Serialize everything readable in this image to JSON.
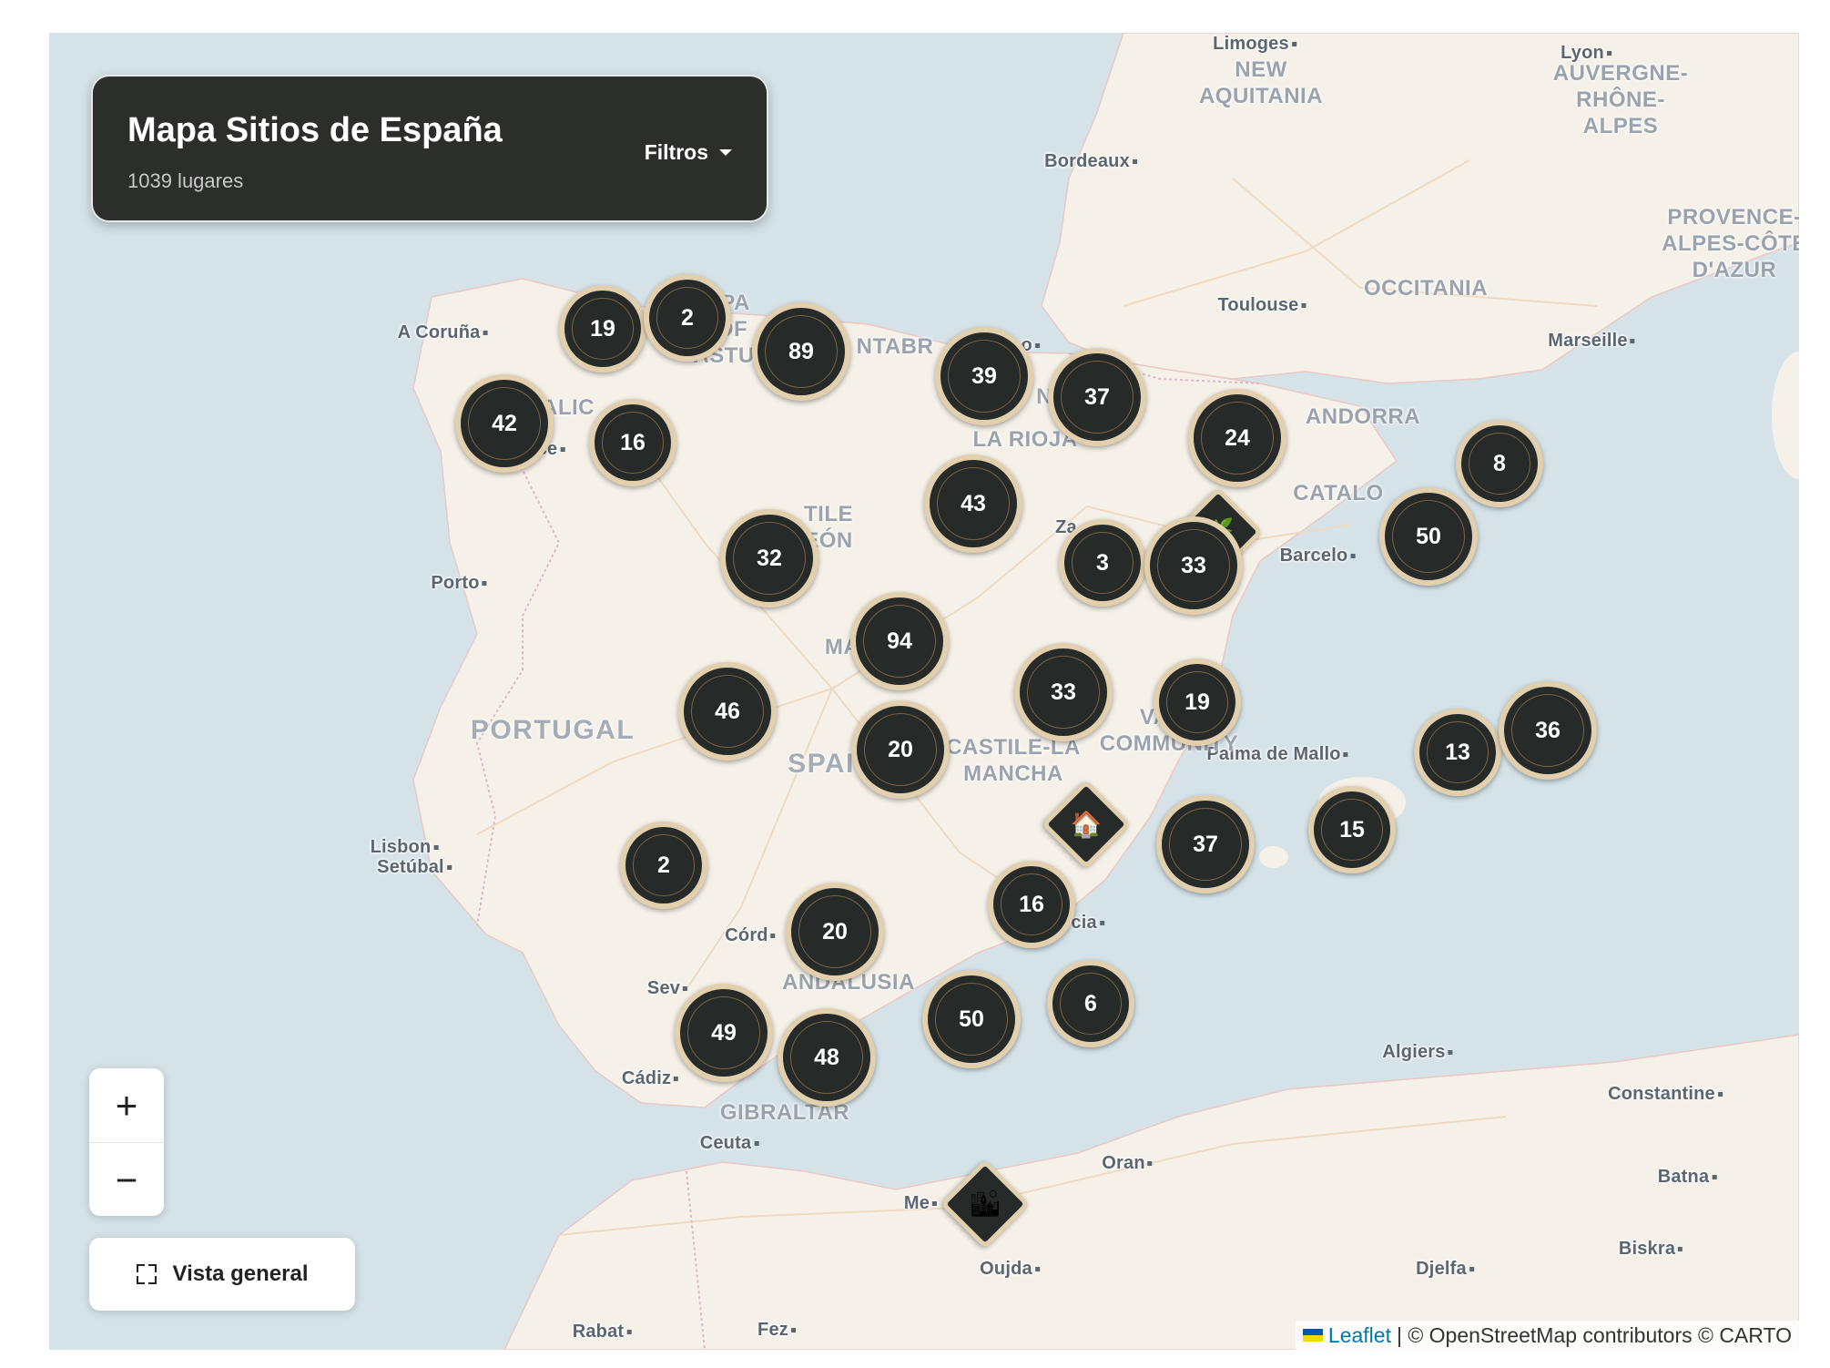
{
  "panel": {
    "title": "Mapa Sitios de España",
    "subtitle": "1039 lugares",
    "filters_label": "Filtros"
  },
  "zoom": {
    "in_label": "+",
    "out_label": "−"
  },
  "overview_label": "Vista general",
  "attribution": {
    "leaflet": "Leaflet",
    "text": "| © OpenStreetMap contributors © CARTO"
  },
  "colors": {
    "water": "#d5e3e8",
    "land": "#f5f1e9",
    "cluster_fill": "#262a28",
    "cluster_ring": "#e2cfae",
    "panel_bg": "#2c2e2c"
  },
  "places": [
    {
      "label": "Limoges"
    },
    {
      "label": "Lyon"
    },
    {
      "label": "Bordeaux"
    },
    {
      "label": "Toulouse"
    },
    {
      "label": "Marseille"
    },
    {
      "label": "A Coruña"
    },
    {
      "label": "Porto"
    },
    {
      "label": "Lisbon"
    },
    {
      "label": "Setúbal"
    },
    {
      "label": "Barcelo"
    },
    {
      "label": "Palma de Mallo"
    },
    {
      "label": "Murcia"
    },
    {
      "label": "Córd"
    },
    {
      "label": "Sev"
    },
    {
      "label": "Cádiz"
    },
    {
      "label": "Ceuta"
    },
    {
      "label": "Algiers"
    },
    {
      "label": "Constantine"
    },
    {
      "label": "Oran"
    },
    {
      "label": "Batna"
    },
    {
      "label": "Biskra"
    },
    {
      "label": "Me"
    },
    {
      "label": "Oujda"
    },
    {
      "label": "Djelfa"
    },
    {
      "label": "Rabat"
    },
    {
      "label": "Fez"
    },
    {
      "label": "ao"
    },
    {
      "label": "Za"
    },
    {
      "label": "se"
    }
  ],
  "regions": [
    {
      "label": "NEW\nAQUITANIA"
    },
    {
      "label": "AUVERGNE-\nRHÔNE-\nALPES"
    },
    {
      "label": "PROVENCE-\nALPES-CÔTE\nD'AZUR"
    },
    {
      "label": "OCCITANIA"
    },
    {
      "label": "ANDORRA"
    },
    {
      "label": "CATALO"
    },
    {
      "label": "LA RIOJA"
    },
    {
      "label": "ANDALUSIA"
    },
    {
      "label": "GIBRALTAR"
    },
    {
      "label": "CASTILE-LA\nMANCHA"
    },
    {
      "label": "VALE\nCOMMUNITY"
    },
    {
      "label": "TILE\nEÓN"
    },
    {
      "label": "ALIC"
    },
    {
      "label": "IPA\nOF\nASTUR"
    },
    {
      "label": "NTABR"
    },
    {
      "label": "MA"
    },
    {
      "label": "N"
    }
  ],
  "countries": [
    {
      "label": "PORTUGAL"
    },
    {
      "label": "SPAI"
    }
  ],
  "clusters": [
    {
      "count": "19"
    },
    {
      "count": "2"
    },
    {
      "count": "89"
    },
    {
      "count": "39"
    },
    {
      "count": "37"
    },
    {
      "count": "42"
    },
    {
      "count": "16"
    },
    {
      "count": "24"
    },
    {
      "count": "8"
    },
    {
      "count": "43"
    },
    {
      "count": "32"
    },
    {
      "count": "3"
    },
    {
      "count": "33"
    },
    {
      "count": "50"
    },
    {
      "count": "94"
    },
    {
      "count": "33"
    },
    {
      "count": "19"
    },
    {
      "count": "46"
    },
    {
      "count": "20"
    },
    {
      "count": "13"
    },
    {
      "count": "36"
    },
    {
      "count": "2"
    },
    {
      "count": "37"
    },
    {
      "count": "15"
    },
    {
      "count": "16"
    },
    {
      "count": "20"
    },
    {
      "count": "6"
    },
    {
      "count": "50"
    },
    {
      "count": "49"
    },
    {
      "count": "48"
    }
  ],
  "pins": [
    {
      "icon": "house-icon",
      "glyph": "🏠"
    },
    {
      "icon": "city-icon",
      "glyph": "🏙"
    },
    {
      "icon": "leaf-icon",
      "glyph": "🌿"
    }
  ]
}
